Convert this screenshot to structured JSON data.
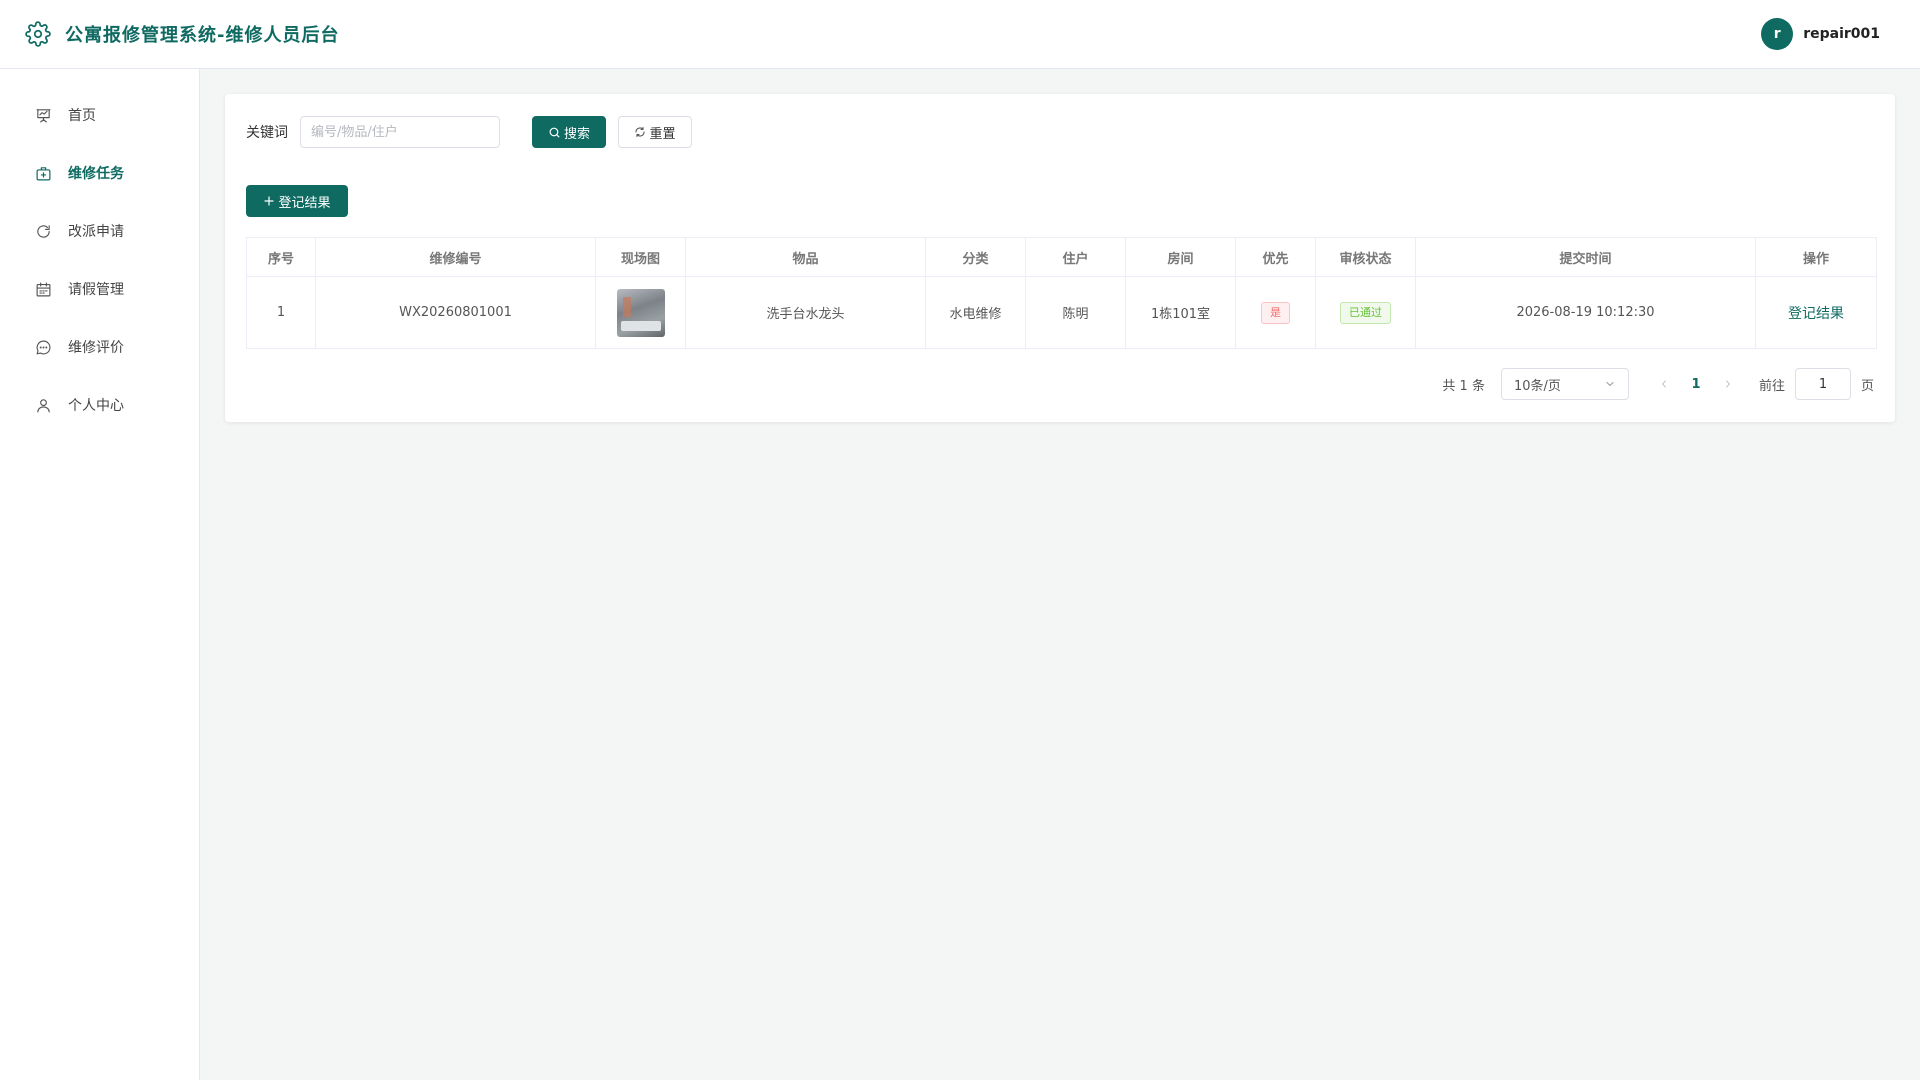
{
  "header": {
    "title": "公寓报修管理系统-维修人员后台",
    "logo_icon": "gear-icon",
    "user": {
      "avatar_letter": "r",
      "name": "repair001"
    }
  },
  "colors": {
    "brand": "#0f6b62",
    "danger": "#f56c6c",
    "success": "#67c23a"
  },
  "sidebar": {
    "items": [
      {
        "label": "首页",
        "icon": "presentation-icon",
        "active": false
      },
      {
        "label": "维修任务",
        "icon": "first-aid-kit-icon",
        "active": true
      },
      {
        "label": "改派申请",
        "icon": "refresh-icon",
        "active": false
      },
      {
        "label": "请假管理",
        "icon": "calendar-icon",
        "active": false
      },
      {
        "label": "维修评价",
        "icon": "chat-bubble-icon",
        "active": false
      },
      {
        "label": "个人中心",
        "icon": "user-icon",
        "active": false
      }
    ]
  },
  "search": {
    "label": "关键词",
    "value": "",
    "placeholder": "编号/物品/住户",
    "search_label": "搜索",
    "reset_label": "重置"
  },
  "toolbar": {
    "add_label": "登记结果"
  },
  "table": {
    "columns": [
      "序号",
      "维修编号",
      "现场图",
      "物品",
      "分类",
      "住户",
      "房间",
      "优先",
      "审核状态",
      "提交时间",
      "操作"
    ],
    "rows": [
      {
        "index": "1",
        "code": "WX20260801001",
        "photo": "site-photo",
        "item": "洗手台水龙头",
        "category": "水电维修",
        "resident": "陈明",
        "room": "1栋101室",
        "priority": "是",
        "status": "已通过",
        "submitted": "2026-08-19 10:12:30",
        "action": "登记结果"
      }
    ]
  },
  "pagination": {
    "total_text": "共 1 条",
    "page_size": "10条/页",
    "current_page": "1",
    "goto_label": "前往",
    "goto_value": "1",
    "goto_suffix": "页"
  }
}
